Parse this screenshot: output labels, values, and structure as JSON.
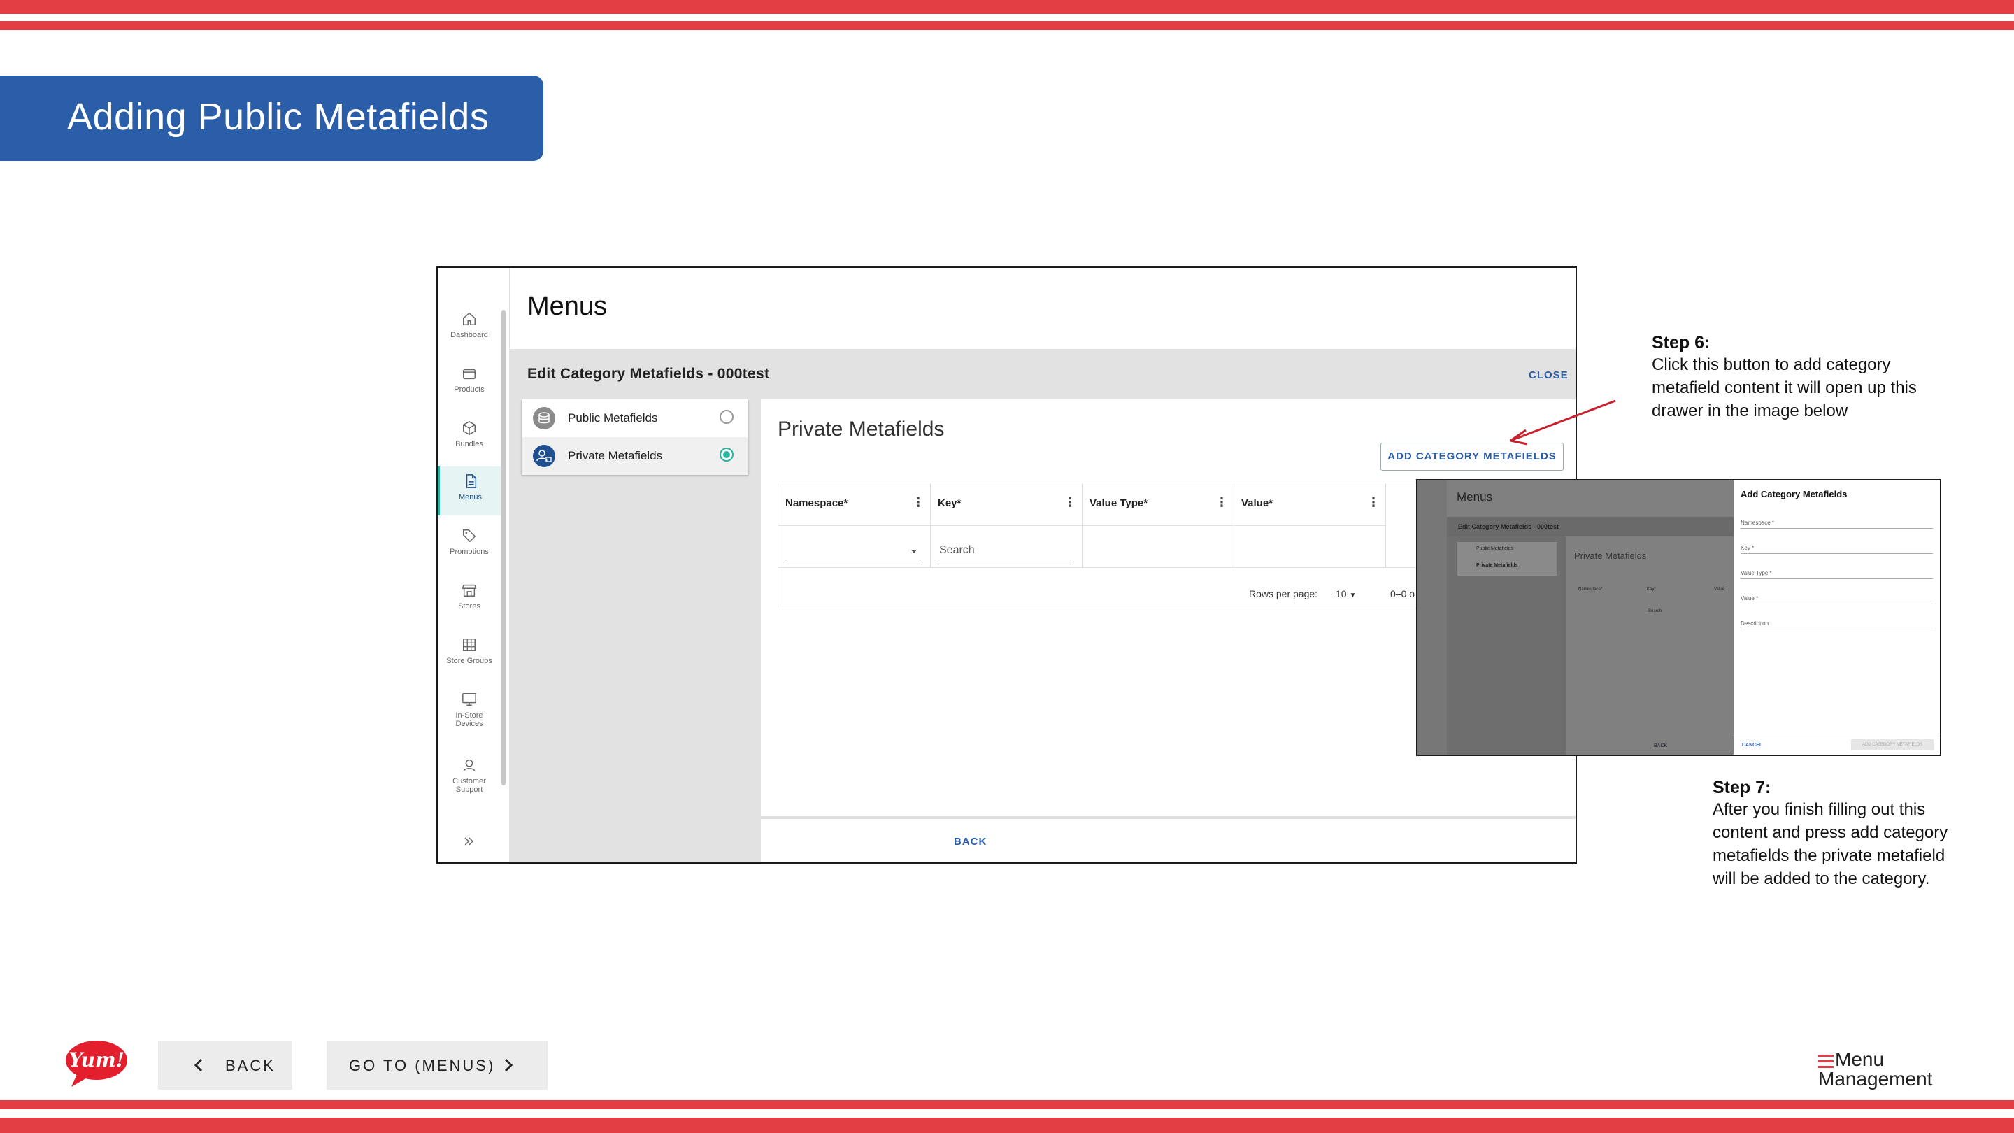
{
  "slide": {
    "title": "Adding Public Metafields",
    "colors": {
      "stripe": "#e33e43",
      "banner": "#2a5ea8",
      "accent": "#2bb5a0"
    }
  },
  "app": {
    "page_title": "Menus",
    "sidebar": {
      "items": [
        {
          "label": "Dashboard",
          "icon": "home-icon"
        },
        {
          "label": "Products",
          "icon": "box-icon"
        },
        {
          "label": "Bundles",
          "icon": "cube-icon"
        },
        {
          "label": "Menus",
          "icon": "document-icon",
          "active": true
        },
        {
          "label": "Promotions",
          "icon": "tag-icon"
        },
        {
          "label": "Stores",
          "icon": "store-icon"
        },
        {
          "label": "Store Groups",
          "icon": "grid-icon"
        },
        {
          "label": "In-Store",
          "label2": "Devices",
          "icon": "monitor-icon"
        },
        {
          "label": "Customer",
          "label2": "Support",
          "icon": "headset-icon"
        }
      ],
      "collapse_icon": "double-chevron-right-icon"
    },
    "edit_title": "Edit Category Metafields - 000test",
    "close_label": "CLOSE",
    "metafield_types": [
      {
        "label": "Public Metafields",
        "selected": false
      },
      {
        "label": "Private Metafields",
        "selected": true
      }
    ],
    "section_title": "Private Metafields",
    "add_button_label": "ADD CATEGORY METAFIELDS",
    "table": {
      "columns": [
        "Namespace*",
        "Key*",
        "Value Type*",
        "Value*"
      ],
      "search_placeholder": "Search",
      "rows_per_page_label": "Rows per page:",
      "rows_per_page_value": "10",
      "pagination": "0–0 o"
    },
    "back_label": "BACK"
  },
  "inset": {
    "page_title": "Menus",
    "edit_title": "Edit Category Metafields - 000test",
    "public_label": "Public Metafields",
    "private_label": "Private Metafields",
    "section_title": "Private Metafields",
    "columns": [
      "Namespace*",
      "Key*",
      "Value T"
    ],
    "search": "Search",
    "back": "BACK",
    "drawer": {
      "title": "Add Category Metafields",
      "fields": [
        "Namespace *",
        "Key *",
        "Value Type *",
        "Value *",
        "Description"
      ],
      "cancel": "CANCEL",
      "submit": "ADD CATEGORY METAFIELDS"
    }
  },
  "steps": {
    "step6": {
      "heading": "Step 6:",
      "lines": [
        "Click this button to add category",
        "metafield content it will open up this",
        "drawer in the image below"
      ]
    },
    "step7": {
      "heading": "Step 7:",
      "lines": [
        "After you finish filling out this",
        "content and press add category",
        "metafields the private metafield",
        "will be added to the category."
      ]
    }
  },
  "footer": {
    "back_label": "BACK",
    "goto_label": "GO TO (MENUS)",
    "yum_logo_text": "Yum!",
    "brand_line1": "Menu",
    "brand_line2": "Management"
  }
}
